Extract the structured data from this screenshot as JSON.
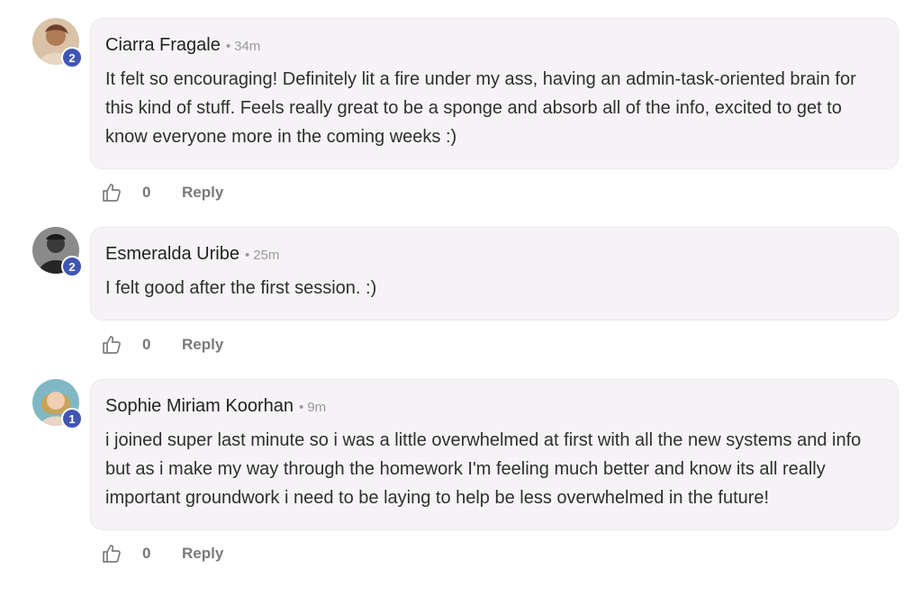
{
  "comments": [
    {
      "author": "Ciarra Fragale",
      "separator": "•",
      "time": "34m",
      "badge": "2",
      "text": "It felt so encouraging! Definitely lit a fire under my ass, having an admin-task-oriented brain for this kind of stuff. Feels really great to be a sponge and absorb all of the info, excited to get to know everyone more in the coming weeks :)",
      "likes": "0",
      "reply_label": "Reply"
    },
    {
      "author": "Esmeralda Uribe",
      "separator": "•",
      "time": "25m",
      "badge": "2",
      "text": "I felt good after the first session. :)",
      "likes": "0",
      "reply_label": "Reply"
    },
    {
      "author": "Sophie Miriam Koorhan",
      "separator": "•",
      "time": "9m",
      "badge": "1",
      "text": "i joined super last minute so i was a little overwhelmed at first with all the new systems and info but as i make my way through the homework I'm feeling much better and know its all really important groundwork i need to be laying to help be less overwhelmed in the future!",
      "likes": "0",
      "reply_label": "Reply"
    }
  ],
  "icons": {
    "like": "thumbs-up-icon",
    "avatar": "avatar-photo"
  },
  "colors": {
    "badge": "#3f56b5",
    "bubble": "#f6f3f6",
    "muted": "#7a7a7a"
  }
}
